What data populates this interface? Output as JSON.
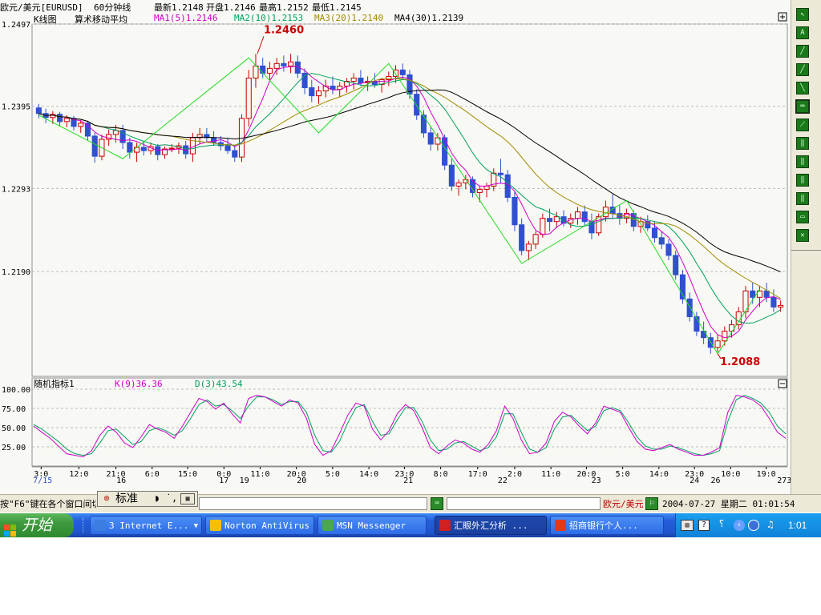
{
  "titlebar": {
    "symbol": "欧元/美元[EURUSD]",
    "period": "60分钟线",
    "latest": "最新1.2148",
    "open": "开盘1.2146",
    "high": "最高1.2152",
    "low": "最低1.2145"
  },
  "main_panel": {
    "chart_kind": "K线图",
    "indicator_name": "算术移动平均",
    "ma_labels": [
      {
        "text": "MA1(5)1.2146",
        "color": "#cc00cc"
      },
      {
        "text": "MA2(10)1.2153",
        "color": "#00a060"
      },
      {
        "text": "MA3(20)1.2140",
        "color": "#a08c00"
      },
      {
        "text": "MA4(30)1.2139",
        "color": "#000000"
      }
    ],
    "high_marker": "1.2460",
    "low_marker": "1.2088"
  },
  "sub_panel": {
    "title": "随机指标1",
    "k_label": "K(9)36.36",
    "d_label": "D(3)43.54",
    "k_color": "#cc00cc",
    "d_color": "#00a060"
  },
  "chart_data": [
    {
      "type": "candlestick",
      "title": "",
      "y_ticks": [
        "1.2497",
        "1.2395",
        "1.2293",
        "1.2190"
      ],
      "ylim": [
        1.206,
        1.2497
      ],
      "grid": true,
      "candles": [
        [
          1.2393,
          1.2398,
          1.238,
          1.2386
        ],
        [
          1.2386,
          1.2392,
          1.2374,
          1.2381
        ],
        [
          1.2381,
          1.2389,
          1.2373,
          1.2385
        ],
        [
          1.2385,
          1.2388,
          1.237,
          1.2376
        ],
        [
          1.2376,
          1.2384,
          1.2369,
          1.238
        ],
        [
          1.238,
          1.2383,
          1.2365,
          1.237
        ],
        [
          1.237,
          1.2378,
          1.2362,
          1.2374
        ],
        [
          1.2374,
          1.2377,
          1.2352,
          1.2358
        ],
        [
          1.2358,
          1.2362,
          1.2325,
          1.2333
        ],
        [
          1.2333,
          1.236,
          1.2328,
          1.2354
        ],
        [
          1.2354,
          1.2366,
          1.2346,
          1.236
        ],
        [
          1.236,
          1.2372,
          1.235,
          1.2365
        ],
        [
          1.2365,
          1.2372,
          1.2342,
          1.235
        ],
        [
          1.235,
          1.2356,
          1.233,
          1.2338
        ],
        [
          1.2338,
          1.235,
          1.2326,
          1.2344
        ],
        [
          1.2344,
          1.2352,
          1.2334,
          1.234
        ],
        [
          1.234,
          1.235,
          1.2335,
          1.2345
        ],
        [
          1.2345,
          1.2348,
          1.2328,
          1.2335
        ],
        [
          1.2335,
          1.2345,
          1.233,
          1.2342
        ],
        [
          1.2342,
          1.2348,
          1.2338,
          1.2343
        ],
        [
          1.2343,
          1.235,
          1.2336,
          1.2346
        ],
        [
          1.2346,
          1.2352,
          1.233,
          1.2336
        ],
        [
          1.2336,
          1.2362,
          1.2326,
          1.2356
        ],
        [
          1.2356,
          1.2368,
          1.2348,
          1.236
        ],
        [
          1.236,
          1.2368,
          1.235,
          1.2356
        ],
        [
          1.2356,
          1.2364,
          1.2346,
          1.235
        ],
        [
          1.235,
          1.2358,
          1.234,
          1.2346
        ],
        [
          1.2346,
          1.2356,
          1.2336,
          1.234
        ],
        [
          1.234,
          1.2346,
          1.2326,
          1.2332
        ],
        [
          1.2332,
          1.2385,
          1.2326,
          1.238
        ],
        [
          1.238,
          1.244,
          1.237,
          1.243
        ],
        [
          1.243,
          1.246,
          1.2418,
          1.2445
        ],
        [
          1.2445,
          1.2455,
          1.243,
          1.2436
        ],
        [
          1.2436,
          1.245,
          1.2428,
          1.2442
        ],
        [
          1.2442,
          1.2455,
          1.2434,
          1.2448
        ],
        [
          1.2448,
          1.2458,
          1.2438,
          1.2445
        ],
        [
          1.2445,
          1.246,
          1.2436,
          1.245
        ],
        [
          1.245,
          1.2458,
          1.243,
          1.2436
        ],
        [
          1.2436,
          1.2442,
          1.241,
          1.2418
        ],
        [
          1.2418,
          1.2428,
          1.24,
          1.2408
        ],
        [
          1.2408,
          1.242,
          1.2398,
          1.2414
        ],
        [
          1.2414,
          1.2428,
          1.2406,
          1.242
        ],
        [
          1.242,
          1.2432,
          1.241,
          1.2416
        ],
        [
          1.2416,
          1.2425,
          1.2406,
          1.242
        ],
        [
          1.242,
          1.243,
          1.2412,
          1.2426
        ],
        [
          1.2426,
          1.2436,
          1.2416,
          1.243
        ],
        [
          1.243,
          1.244,
          1.242,
          1.2424
        ],
        [
          1.2424,
          1.2432,
          1.2414,
          1.2426
        ],
        [
          1.2426,
          1.2436,
          1.2418,
          1.2422
        ],
        [
          1.2422,
          1.243,
          1.2412,
          1.2428
        ],
        [
          1.2428,
          1.2438,
          1.242,
          1.2432
        ],
        [
          1.2432,
          1.2446,
          1.2424,
          1.244
        ],
        [
          1.244,
          1.2448,
          1.2428,
          1.2434
        ],
        [
          1.2434,
          1.244,
          1.2404,
          1.241
        ],
        [
          1.241,
          1.2416,
          1.2378,
          1.2384
        ],
        [
          1.2384,
          1.239,
          1.2356,
          1.2362
        ],
        [
          1.2362,
          1.237,
          1.234,
          1.2348
        ],
        [
          1.2348,
          1.2362,
          1.234,
          1.2356
        ],
        [
          1.2356,
          1.236,
          1.2316,
          1.2322
        ],
        [
          1.2322,
          1.233,
          1.229,
          1.2296
        ],
        [
          1.2296,
          1.2304,
          1.2284,
          1.23
        ],
        [
          1.23,
          1.231,
          1.2292,
          1.2304
        ],
        [
          1.2304,
          1.2308,
          1.2282,
          1.2288
        ],
        [
          1.2288,
          1.2296,
          1.2276,
          1.2292
        ],
        [
          1.2292,
          1.23,
          1.2282,
          1.2296
        ],
        [
          1.2296,
          1.2318,
          1.229,
          1.2312
        ],
        [
          1.2312,
          1.233,
          1.23,
          1.231
        ],
        [
          1.231,
          1.2316,
          1.2276,
          1.2282
        ],
        [
          1.2282,
          1.229,
          1.224,
          1.2248
        ],
        [
          1.2248,
          1.2256,
          1.221,
          1.2216
        ],
        [
          1.2216,
          1.2228,
          1.2204,
          1.2224
        ],
        [
          1.2224,
          1.224,
          1.2218,
          1.2236
        ],
        [
          1.2236,
          1.2262,
          1.2232,
          1.2256
        ],
        [
          1.2256,
          1.2268,
          1.224,
          1.2252
        ],
        [
          1.2252,
          1.2264,
          1.2244,
          1.2258
        ],
        [
          1.2258,
          1.2266,
          1.2246,
          1.225
        ],
        [
          1.225,
          1.2262,
          1.2244,
          1.2256
        ],
        [
          1.2256,
          1.227,
          1.2248,
          1.2264
        ],
        [
          1.2264,
          1.2272,
          1.2246,
          1.2252
        ],
        [
          1.2252,
          1.2262,
          1.223,
          1.2238
        ],
        [
          1.2238,
          1.2262,
          1.2234,
          1.2258
        ],
        [
          1.2258,
          1.2278,
          1.2252,
          1.227
        ],
        [
          1.227,
          1.2286,
          1.2256,
          1.2262
        ],
        [
          1.2262,
          1.2272,
          1.2248,
          1.2256
        ],
        [
          1.2256,
          1.2268,
          1.225,
          1.2262
        ],
        [
          1.2262,
          1.2266,
          1.224,
          1.2246
        ],
        [
          1.2246,
          1.2258,
          1.2238,
          1.2252
        ],
        [
          1.2252,
          1.226,
          1.224,
          1.2244
        ],
        [
          1.2244,
          1.2252,
          1.2226,
          1.2232
        ],
        [
          1.2232,
          1.224,
          1.2218,
          1.2224
        ],
        [
          1.2224,
          1.223,
          1.2204,
          1.221
        ],
        [
          1.221,
          1.2216,
          1.218,
          1.2186
        ],
        [
          1.2186,
          1.2192,
          1.215,
          1.2156
        ],
        [
          1.2156,
          1.2164,
          1.2128,
          1.2134
        ],
        [
          1.2134,
          1.214,
          1.211,
          1.2116
        ],
        [
          1.2116,
          1.2128,
          1.21,
          1.2108
        ],
        [
          1.2108,
          1.2114,
          1.2088,
          1.2096
        ],
        [
          1.2096,
          1.2112,
          1.209,
          1.2104
        ],
        [
          1.2104,
          1.2122,
          1.2098,
          1.2116
        ],
        [
          1.2116,
          1.213,
          1.2108,
          1.2124
        ],
        [
          1.2124,
          1.2146,
          1.2118,
          1.214
        ],
        [
          1.214,
          1.2172,
          1.2132,
          1.2166
        ],
        [
          1.2166,
          1.2176,
          1.215,
          1.2158
        ],
        [
          1.2158,
          1.2172,
          1.2146,
          1.2166
        ],
        [
          1.2166,
          1.2176,
          1.2152,
          1.2158
        ],
        [
          1.2158,
          1.2168,
          1.214,
          1.2146
        ],
        [
          1.2146,
          1.2154,
          1.214,
          1.2148
        ]
      ]
    },
    {
      "type": "line",
      "title": "随机指标1",
      "y_ticks": [
        "100.00",
        "75.00",
        "50.00",
        "25.00"
      ],
      "ylim": [
        0,
        100
      ],
      "grid": true,
      "x_labels": [
        {
          "text": "3:0",
          "pos": 0.012
        },
        {
          "text": "7/15",
          "pos": 0.014,
          "row": 2
        },
        {
          "text": "12:0",
          "pos": 0.062
        },
        {
          "text": "21:0",
          "pos": 0.111
        },
        {
          "text": "16",
          "pos": 0.118,
          "row": 2
        },
        {
          "text": "6:0",
          "pos": 0.159
        },
        {
          "text": "15:0",
          "pos": 0.206
        },
        {
          "text": "0:0",
          "pos": 0.254
        },
        {
          "text": "17",
          "pos": 0.254,
          "row": 2
        },
        {
          "text": "19",
          "pos": 0.281,
          "row": 2
        },
        {
          "text": "11:0",
          "pos": 0.302
        },
        {
          "text": "20:0",
          "pos": 0.35
        },
        {
          "text": "20",
          "pos": 0.357,
          "row": 2
        },
        {
          "text": "5:0",
          "pos": 0.398
        },
        {
          "text": "14:0",
          "pos": 0.446
        },
        {
          "text": "23:0",
          "pos": 0.493
        },
        {
          "text": "21",
          "pos": 0.498,
          "row": 2
        },
        {
          "text": "8:0",
          "pos": 0.541
        },
        {
          "text": "17:0",
          "pos": 0.59
        },
        {
          "text": "2:0",
          "pos": 0.639
        },
        {
          "text": "22",
          "pos": 0.623,
          "row": 2
        },
        {
          "text": "11:0",
          "pos": 0.687
        },
        {
          "text": "20:0",
          "pos": 0.734
        },
        {
          "text": "23",
          "pos": 0.747,
          "row": 2
        },
        {
          "text": "5:0",
          "pos": 0.782
        },
        {
          "text": "14:0",
          "pos": 0.83
        },
        {
          "text": "23:0",
          "pos": 0.877
        },
        {
          "text": "24",
          "pos": 0.877,
          "row": 2
        },
        {
          "text": "26",
          "pos": 0.905,
          "row": 2
        },
        {
          "text": "10:0",
          "pos": 0.925
        },
        {
          "text": "19:0",
          "pos": 0.972
        },
        {
          "text": "273",
          "pos": 0.996,
          "row": 2
        }
      ],
      "series": [
        {
          "name": "K(9)",
          "values": [
            52,
            44,
            36,
            26,
            16,
            14,
            12,
            20,
            40,
            52,
            44,
            30,
            24,
            38,
            54,
            48,
            44,
            36,
            52,
            70,
            88,
            84,
            74,
            82,
            68,
            56,
            88,
            92,
            90,
            84,
            78,
            86,
            82,
            62,
            28,
            14,
            20,
            42,
            66,
            82,
            78,
            48,
            34,
            46,
            68,
            80,
            72,
            50,
            24,
            16,
            26,
            34,
            30,
            22,
            18,
            28,
            46,
            78,
            62,
            34,
            16,
            18,
            30,
            58,
            70,
            64,
            52,
            42,
            56,
            78,
            74,
            70,
            50,
            32,
            22,
            20,
            24,
            28,
            22,
            18,
            14,
            14,
            18,
            24,
            70,
            92,
            90,
            86,
            78,
            62,
            44,
            36
          ]
        },
        {
          "name": "D(3)",
          "values": [
            54,
            48,
            40,
            32,
            22,
            16,
            14,
            16,
            30,
            46,
            48,
            38,
            28,
            32,
            46,
            50,
            46,
            40,
            46,
            62,
            80,
            86,
            78,
            80,
            72,
            62,
            78,
            90,
            90,
            86,
            80,
            84,
            84,
            70,
            40,
            20,
            18,
            32,
            56,
            76,
            80,
            58,
            40,
            42,
            60,
            76,
            76,
            58,
            34,
            20,
            22,
            30,
            32,
            26,
            20,
            24,
            38,
            68,
            68,
            44,
            22,
            18,
            24,
            48,
            64,
            66,
            56,
            46,
            52,
            72,
            76,
            72,
            56,
            38,
            26,
            22,
            22,
            26,
            24,
            20,
            16,
            14,
            16,
            20,
            58,
            86,
            92,
            88,
            82,
            70,
            52,
            42
          ]
        }
      ]
    }
  ],
  "status": {
    "hint": "按\"F6\"键在各个窗口间切",
    "ime_mode": "标准",
    "instrument": "欧元/美元",
    "datetime": "2004-07-27 星期二 01:01:54"
  },
  "taskbar": {
    "start_label": "开始",
    "tasks": [
      {
        "label": "3 Internet E...",
        "icon_color": "#3b7de0"
      },
      {
        "label": "Norton AntiVirus",
        "icon_color": "#f2c200"
      },
      {
        "label": "MSN Messenger",
        "icon_color": "#4aa84a"
      },
      {
        "label": "汇眼外汇分析 ...",
        "icon_color": "#d02020"
      },
      {
        "label": "招商银行个人...",
        "icon_color": "#e03a1a"
      }
    ],
    "clock": "1:01"
  }
}
